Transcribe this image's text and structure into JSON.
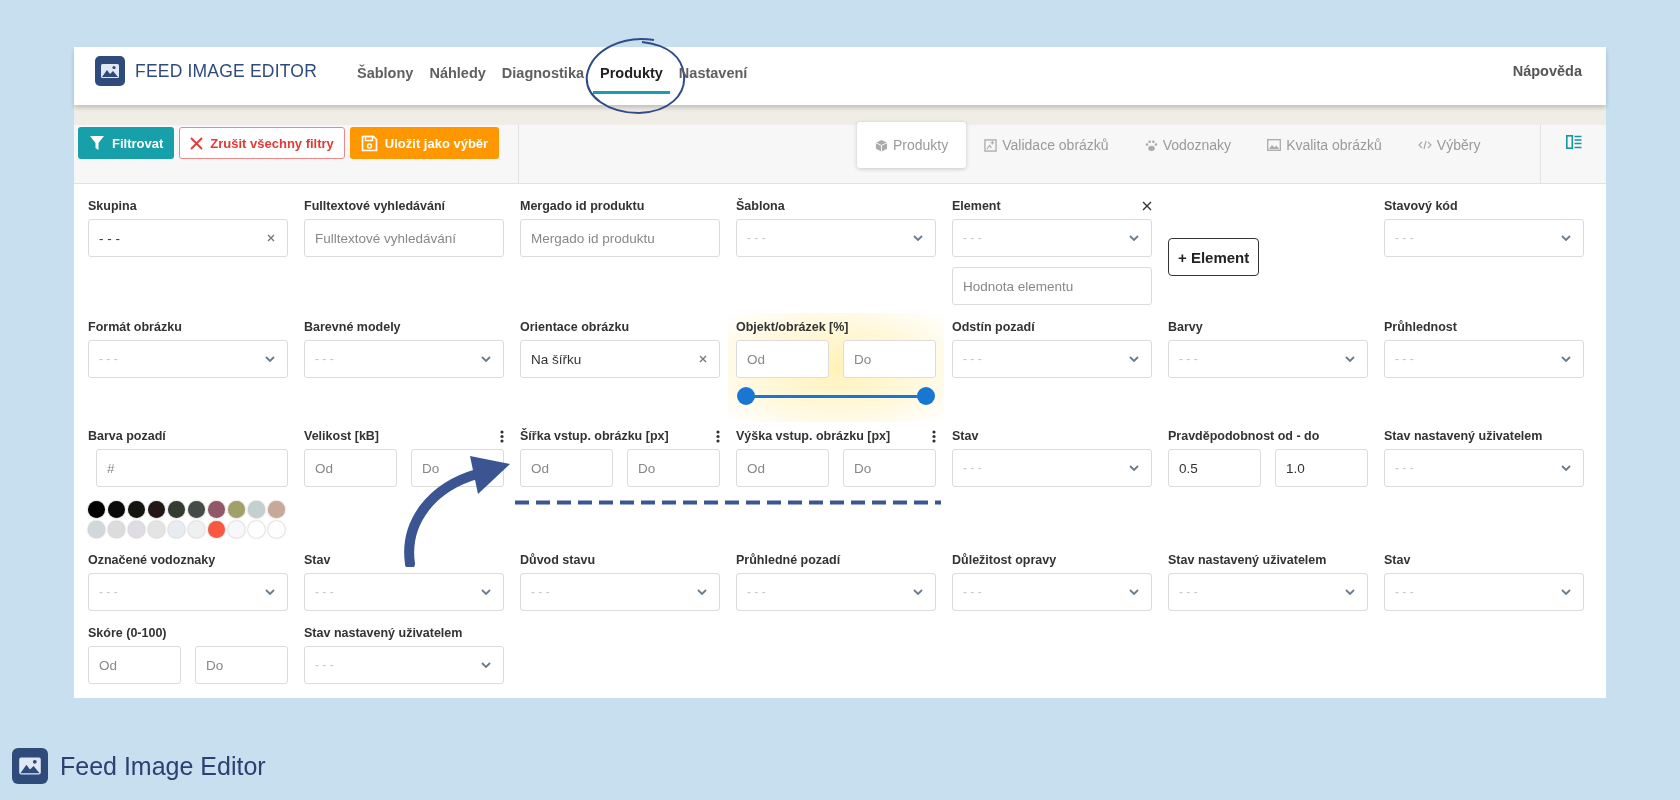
{
  "header": {
    "brand": "FEED IMAGE EDITOR",
    "nav": [
      {
        "label": "Šablony",
        "selected": false
      },
      {
        "label": "Náhledy",
        "selected": false
      },
      {
        "label": "Diagnostika",
        "selected": false
      },
      {
        "label": "Produkty",
        "selected": true
      },
      {
        "label": "Nastavení",
        "selected": false
      }
    ],
    "help": "Nápověda"
  },
  "toolbar": {
    "buttons": [
      {
        "kind": "primary",
        "label": "Filtrovat"
      },
      {
        "kind": "danger",
        "label": "Zrušit všechny filtry"
      },
      {
        "kind": "warning",
        "label": "Uložit jako výběr"
      }
    ],
    "tabs": [
      {
        "label": "Produkty",
        "selected": true
      },
      {
        "label": "Validace obrázků",
        "selected": false
      },
      {
        "label": "Vodoznaky",
        "selected": false
      },
      {
        "label": "Kvalita obrázků",
        "selected": false
      },
      {
        "label": "Výběry",
        "selected": false
      }
    ]
  },
  "filters": [
    [
      {
        "kind": "select",
        "label": "Skupina",
        "value": "- - -",
        "clearable": true
      },
      {
        "kind": "text",
        "label": "Fulltextové vyhledávání",
        "placeholder": "Fulltextové vyhledávání"
      },
      {
        "kind": "text",
        "label": "Mergado id produktu",
        "placeholder": "Mergado id produktu"
      },
      {
        "kind": "select",
        "label": "Šablona",
        "placeholder": "- - -",
        "clearable": false
      },
      {
        "kind": "element",
        "label": "Element",
        "placeholder": "- - -",
        "value_placeholder": "Hodnota elementu",
        "removable": true
      },
      {
        "kind": "button",
        "label": "+ Element"
      },
      {
        "kind": "select",
        "label": "Stavový kód",
        "placeholder": "- - -",
        "clearable": false
      }
    ],
    [
      {
        "kind": "select",
        "label": "Formát obrázku",
        "placeholder": "- - -",
        "clearable": false
      },
      {
        "kind": "select",
        "label": "Barevné modely",
        "placeholder": "- - -",
        "clearable": false
      },
      {
        "kind": "select",
        "label": "Orientace obrázku",
        "value": "Na šířku",
        "clearable": true
      },
      {
        "kind": "range",
        "label": "Objekt/obrázek [%]",
        "inputs": [
          {
            "placeholder": "Od"
          },
          {
            "placeholder": "Do"
          }
        ],
        "menu": false,
        "highlighted": true,
        "slider": [
          {
            "level": 0
          },
          {
            "level": 1
          }
        ]
      },
      {
        "kind": "select",
        "label": "Odstín pozadí",
        "placeholder": "- - -",
        "clearable": false
      },
      {
        "kind": "select",
        "label": "Barvy",
        "placeholder": "- - -",
        "clearable": false
      },
      {
        "kind": "select",
        "label": "Průhlednost",
        "placeholder": "- - -",
        "clearable": false
      }
    ],
    [
      {
        "kind": "color",
        "label": "Barva pozadí",
        "placeholder": "#",
        "swatches": [
          {
            "color": "#000000"
          },
          {
            "color": "#0a0a0a"
          },
          {
            "color": "#141410"
          },
          {
            "color": "#241816"
          },
          {
            "color": "#343c30"
          },
          {
            "color": "#444c48"
          },
          {
            "color": "#905868"
          },
          {
            "color": "#a0a068"
          },
          {
            "color": "#c4d0d0"
          },
          {
            "color": "#c8a898"
          },
          {
            "color": "#d0d8dc"
          },
          {
            "color": "#dcdcdc"
          },
          {
            "color": "#e0dce4"
          },
          {
            "color": "#e4e4e4"
          },
          {
            "color": "#e8ecf0"
          },
          {
            "color": "#f0f0f0"
          },
          {
            "color": "#f85840"
          },
          {
            "color": "#f8f8fc"
          },
          {
            "color": "#ffffff"
          },
          {
            "color": "#fefefe"
          }
        ]
      },
      {
        "kind": "range",
        "label": "Velikost [kB]",
        "inputs": [
          {
            "placeholder": "Od"
          },
          {
            "placeholder": "Do"
          }
        ],
        "menu": true,
        "highlighted": false
      },
      {
        "kind": "range",
        "label": "Šířka vstup. obrázku [px]",
        "inputs": [
          {
            "placeholder": "Od"
          },
          {
            "placeholder": "Do"
          }
        ],
        "menu": true,
        "highlighted": false
      },
      {
        "kind": "range",
        "label": "Výška vstup. obrázku [px]",
        "inputs": [
          {
            "placeholder": "Od"
          },
          {
            "placeholder": "Do"
          }
        ],
        "menu": true,
        "highlighted": false
      },
      {
        "kind": "select",
        "label": "Stav",
        "placeholder": "- - -",
        "clearable": false
      },
      {
        "kind": "range",
        "label": "Pravděpodobnost od - do",
        "inputs": [
          {
            "value": "0.5"
          },
          {
            "value": "1.0"
          }
        ],
        "menu": false,
        "highlighted": false
      },
      {
        "kind": "select",
        "label": "Stav nastavený uživatelem",
        "placeholder": "- - -",
        "clearable": false
      }
    ],
    [
      {
        "kind": "select",
        "label": "Označené vodoznaky",
        "placeholder": "- - -",
        "clearable": false
      },
      {
        "kind": "select",
        "label": "Stav",
        "placeholder": "- - -",
        "clearable": false
      },
      {
        "kind": "select",
        "label": "Důvod stavu",
        "placeholder": "- - -",
        "clearable": false
      },
      {
        "kind": "select",
        "label": "Průhledné pozadí",
        "placeholder": "- - -",
        "clearable": false
      },
      {
        "kind": "select",
        "label": "Důležitost opravy",
        "placeholder": "- - -",
        "clearable": false
      },
      {
        "kind": "select",
        "label": "Stav nastavený uživatelem",
        "placeholder": "- - -",
        "clearable": false
      },
      {
        "kind": "select",
        "label": "Stav",
        "placeholder": "- - -",
        "clearable": false
      }
    ],
    [
      {
        "kind": "range",
        "label": "Skóre (0-100)",
        "inputs": [
          {
            "placeholder": "Od"
          },
          {
            "placeholder": "Do"
          }
        ],
        "menu": false,
        "highlighted": false
      },
      {
        "kind": "select",
        "label": "Stav nastavený uživatelem",
        "placeholder": "- - -",
        "clearable": false
      }
    ]
  ],
  "footer": {
    "title": "Feed Image Editor"
  }
}
